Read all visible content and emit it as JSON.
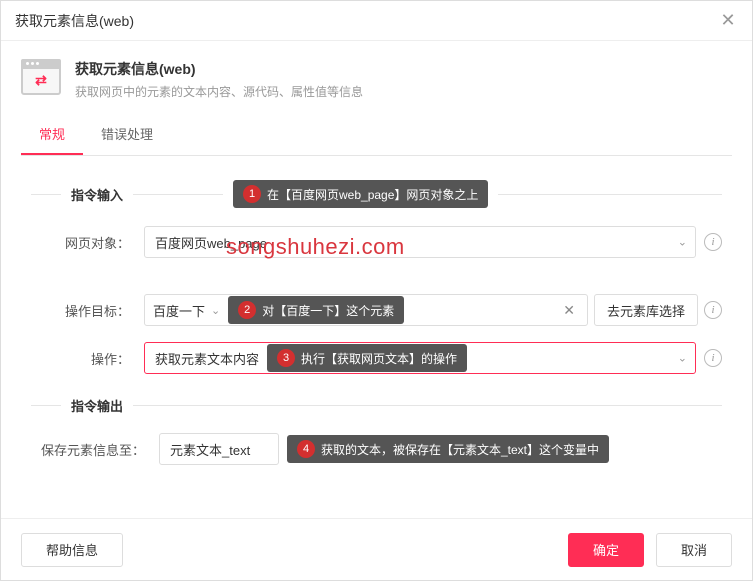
{
  "titlebar": {
    "title": "获取元素信息(web)"
  },
  "header": {
    "title": "获取元素信息(web)",
    "subtitle": "获取网页中的元素的文本内容、源代码、属性值等信息"
  },
  "tabs": {
    "general": "常规",
    "error": "错误处理"
  },
  "sections": {
    "input": "指令输入",
    "output": "指令输出"
  },
  "labels": {
    "web_object": "网页对象：",
    "target": "操作目标：",
    "operation": "操作：",
    "save_to": "保存元素信息至："
  },
  "values": {
    "web_object": "百度网页web_page",
    "target": "百度一下",
    "operation": "获取元素文本内容",
    "save_to": "元素文本_text"
  },
  "buttons": {
    "goto_library": "去元素库选择",
    "help": "帮助信息",
    "ok": "确定",
    "cancel": "取消"
  },
  "annotations": {
    "a1": {
      "num": "1",
      "text": "在【百度网页web_page】网页对象之上"
    },
    "a2": {
      "num": "2",
      "text": "对【百度一下】这个元素"
    },
    "a3": {
      "num": "3",
      "text": "执行【获取网页文本】的操作"
    },
    "a4": {
      "num": "4",
      "text": "获取的文本，被保存在【元素文本_text】这个变量中"
    }
  },
  "watermark": "songshuhezi.com"
}
